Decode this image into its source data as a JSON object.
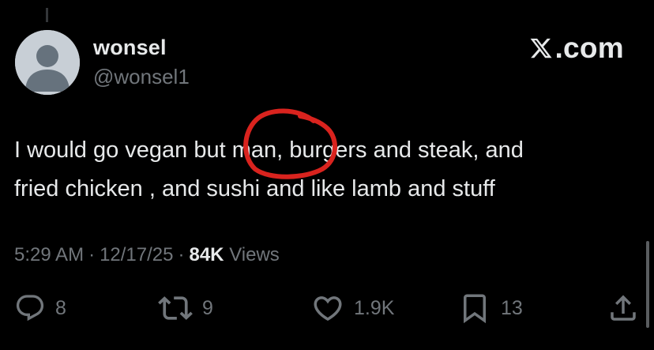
{
  "author": {
    "display_name": "wonsel",
    "handle": "@wonsel1"
  },
  "brand": {
    "label": ".com"
  },
  "tweet": {
    "text": "I would go vegan but man, burgers and steak, and\nfried chicken , and sushi and like lamb and stuff"
  },
  "meta": {
    "time": "5:29 AM",
    "date": "12/17/25",
    "separator": "·",
    "views_count": "84K",
    "views_label": "Views"
  },
  "actions": {
    "replies": "8",
    "reposts": "9",
    "likes": "1.9K",
    "bookmarks": "13"
  },
  "colors": {
    "background": "#000000",
    "primary_text": "#e7e9ea",
    "secondary_text": "#71767b",
    "annotation": "#d9231e"
  },
  "icons": {
    "brand": "x-logo-icon",
    "reply": "reply-icon",
    "repost": "repost-icon",
    "like": "heart-icon",
    "bookmark": "bookmark-icon",
    "share": "share-icon"
  }
}
